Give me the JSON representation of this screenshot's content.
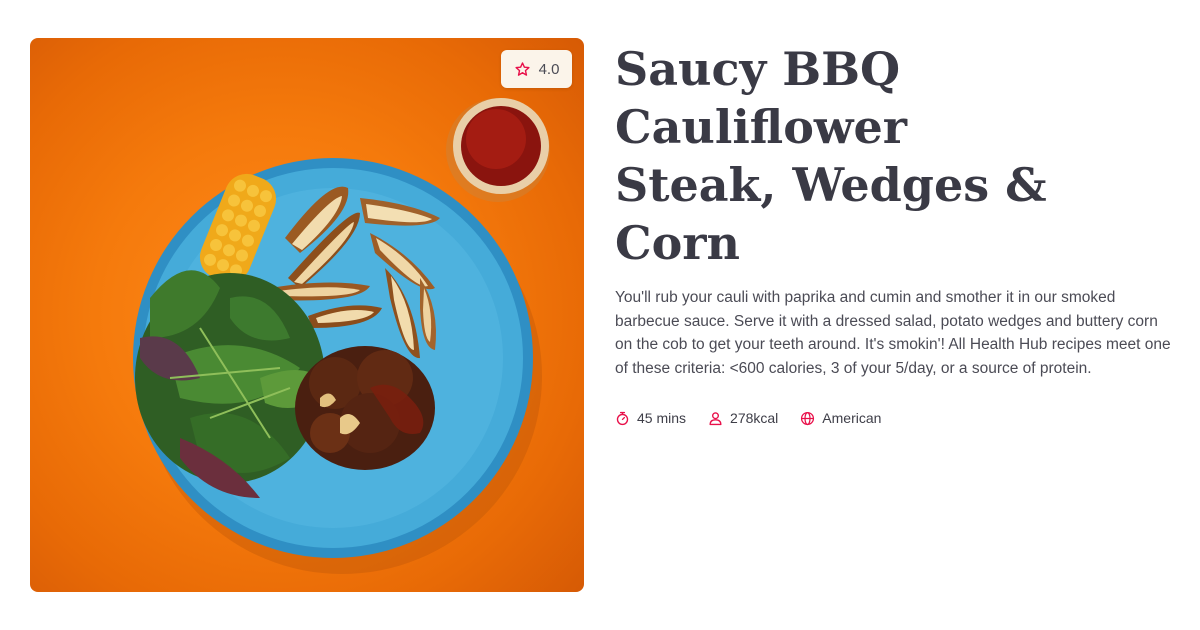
{
  "recipe": {
    "title_line1": "Saucy BBQ Cauliflower",
    "title_line2": "Steak, Wedges & Corn",
    "description": "You'll rub your cauli with paprika and cumin and smother it in our smoked barbecue sauce. Serve it with a dressed salad, potato wedges and buttery corn on the cob to get your teeth around. It's smokin'! All Health Hub recipes meet one of these criteria: <600 calories, 3 of your 5/day, or a source of protein.",
    "rating": "4.0",
    "meta": {
      "time": "45 mins",
      "calories": "278kcal",
      "cuisine": "American"
    }
  },
  "icons": {
    "rating": "star-outline-icon",
    "time": "stopwatch-icon",
    "calories": "person-icon",
    "cuisine": "globe-icon"
  },
  "colors": {
    "accent": "#e8104a",
    "title": "#3a3a45",
    "text": "#4b4b55",
    "hero_background": "#f57a0c",
    "plate": "#3ea7d6",
    "rating_background": "#fbf4ea"
  }
}
